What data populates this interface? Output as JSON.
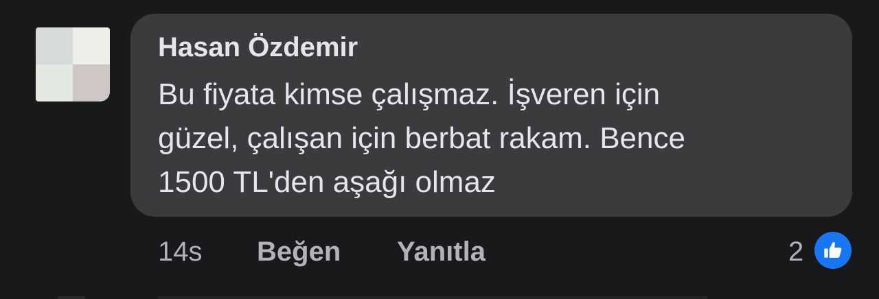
{
  "comment": {
    "author": "Hasan Özdemir",
    "text_lines": [
      "Bu fiyata kimse çalışmaz. İşveren için",
      "güzel, çalışan için berbat rakam. Bence",
      "1500 TL'den aşağı olmaz"
    ],
    "timestamp": "14s",
    "like_label": "Beğen",
    "reply_label": "Yanıtla",
    "reaction_count": "2",
    "reaction_icon": "thumbs-up-icon",
    "colors": {
      "background": "#18191a",
      "bubble": "#3a3b3c",
      "primary_text": "#e4e6eb",
      "secondary_text": "#b0b3b8",
      "like_accent": "#1877f2"
    }
  }
}
